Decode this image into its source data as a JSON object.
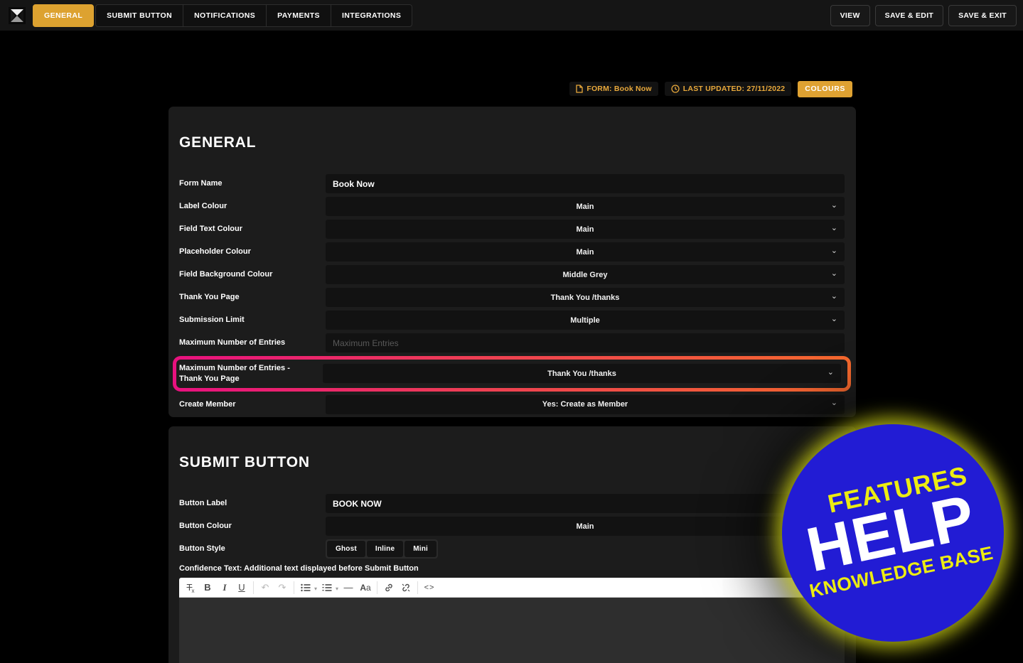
{
  "topbar": {
    "tabs": [
      {
        "label": "GENERAL",
        "active": true
      },
      {
        "label": "SUBMIT BUTTON",
        "active": false
      },
      {
        "label": "NOTIFICATIONS",
        "active": false
      },
      {
        "label": "PAYMENTS",
        "active": false
      },
      {
        "label": "INTEGRATIONS",
        "active": false
      }
    ],
    "actions": [
      {
        "label": "VIEW"
      },
      {
        "label": "SAVE & EDIT"
      },
      {
        "label": "SAVE & EXIT"
      }
    ],
    "logo_icon": "hourglass-mark-icon"
  },
  "meta": {
    "form_badge": {
      "icon": "document-icon",
      "label": "FORM: Book Now"
    },
    "last_updated_badge": {
      "icon": "clock-icon",
      "label": "LAST UPDATED: 27/11/2022"
    },
    "colours_button": "COLOURS"
  },
  "general": {
    "title": "GENERAL",
    "fields": [
      {
        "label": "Form Name",
        "type": "input",
        "value": "Book Now"
      },
      {
        "label": "Label Colour",
        "type": "select",
        "value": "Main"
      },
      {
        "label": "Field Text Colour",
        "type": "select",
        "value": "Main"
      },
      {
        "label": "Placeholder Colour",
        "type": "select",
        "value": "Main"
      },
      {
        "label": "Field Background Colour",
        "type": "select",
        "value": "Middle Grey"
      },
      {
        "label": "Thank You Page",
        "type": "select",
        "value": "Thank You /thanks"
      },
      {
        "label": "Submission Limit",
        "type": "select",
        "value": "Multiple"
      },
      {
        "label": "Maximum Number of Entries",
        "type": "input",
        "placeholder": "Maximum Entries"
      },
      {
        "label": "Maximum Number of Entries - Thank You Page",
        "type": "select",
        "value": "Thank You /thanks",
        "highlighted": true
      },
      {
        "label": "Create Member",
        "type": "select",
        "value": "Yes: Create as Member"
      }
    ]
  },
  "submit_button": {
    "title": "SUBMIT BUTTON",
    "button_label": {
      "label": "Button Label",
      "value": "BOOK NOW"
    },
    "button_colour": {
      "label": "Button Colour",
      "value": "Main"
    },
    "button_style": {
      "label": "Button Style",
      "options": [
        "Ghost",
        "Inline",
        "Mini"
      ]
    },
    "confidence_label": "Confidence Text: Additional text displayed before Submit Button",
    "editor_toolbar_icons": [
      "clear-formatting-icon",
      "bold-icon",
      "italic-icon",
      "underline-icon",
      "undo-icon",
      "redo-icon",
      "bullet-list-icon",
      "numbered-list-icon",
      "horizontal-rule-icon",
      "font-size-icon",
      "link-icon",
      "unlink-icon",
      "code-icon"
    ]
  },
  "help_badge": {
    "line1": "FEATURES",
    "line2": "HELP",
    "line3": "KNOWLEDGE BASE"
  },
  "colors": {
    "accent_gold": "#dda230",
    "badge_text_gold": "#e9a93b",
    "highlight_gradient_from": "#e8117f",
    "highlight_gradient_to": "#f4682d",
    "help_badge_blue": "#221cd4",
    "help_badge_glow": "#d5d816",
    "panel_bg": "#1c1c1c",
    "field_bg": "#121212",
    "editor_body_bg": "#2e2e2e"
  }
}
